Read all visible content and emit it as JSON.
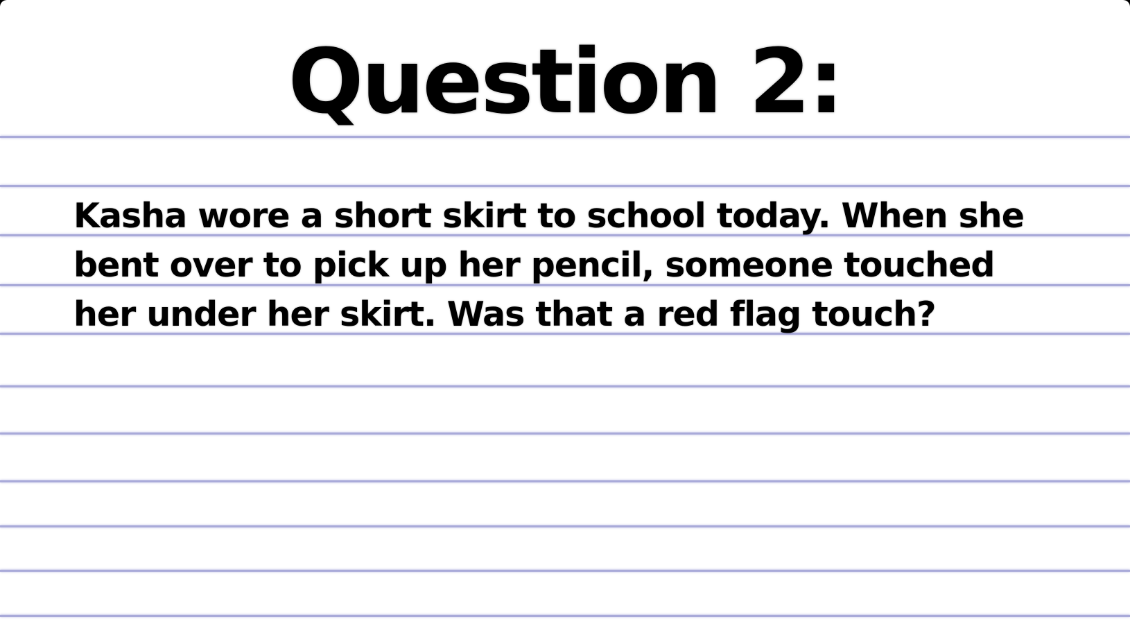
{
  "slide": {
    "title": "Question 2:",
    "question": "Kasha wore a short skirt to school today. When she bent over to pick up her pencil, someone touched her under her skirt. Was that a red flag touch?"
  },
  "colors": {
    "background": "#ffffff",
    "ruled_line": "#a9aad9",
    "text": "#000000"
  }
}
